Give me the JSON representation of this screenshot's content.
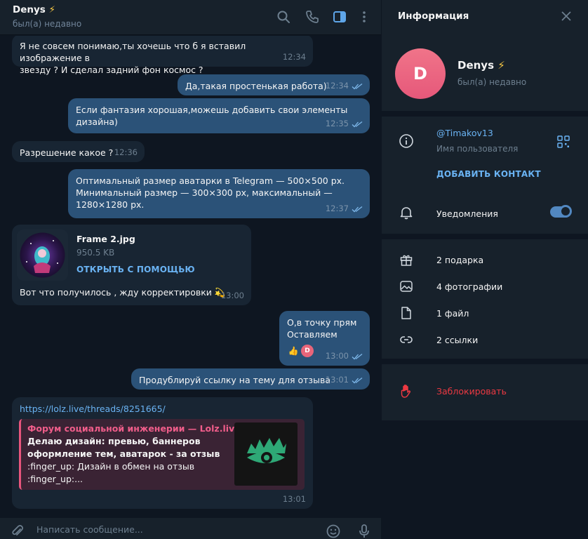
{
  "chat": {
    "title": "Denys",
    "title_emoji": "⚡",
    "status": "был(а) недавно",
    "header_icons": [
      "search-icon",
      "phone-icon",
      "sidebar-toggle-icon",
      "more-vert-icon"
    ]
  },
  "messages": [
    {
      "dir": "in",
      "text1": "Я не совсем понимаю,ты хочешь что б я вставил изображение в",
      "text2": "звезду ? И сделал задний фон космос ?",
      "time": "12:34"
    },
    {
      "dir": "out",
      "text": "Да,такая простенькая работа)",
      "time": "12:34",
      "read": true
    },
    {
      "dir": "out",
      "text1": "Если фантазия хорошая,можешь добавить свои элементы",
      "text2": "дизайна)",
      "time": "12:35",
      "read": true
    },
    {
      "dir": "in",
      "text": "Разрешение какое ?",
      "time": "12:36"
    },
    {
      "dir": "out",
      "text1": "Оптимальный размер аватарки в Telegram — 500×500 px.",
      "text2": "Минимальный размер — 300×300 px, максимальный —",
      "text3": "1280×1280 px.",
      "time": "12:37",
      "read": true
    },
    {
      "dir": "in",
      "file_name": "Frame 2.jpg",
      "file_size": "950.5 KB",
      "open_with": "ОТКРЫТЬ С ПОМОЩЬЮ",
      "caption": "Вот что получилось , жду корректировки",
      "caption_emoji": "💫",
      "time": "13:00"
    },
    {
      "dir": "out",
      "text1": "О,в точку прям",
      "text2": "Оставляем",
      "reaction_emoji": "👍",
      "reaction_avatar": "D",
      "time": "13:00",
      "read": true
    },
    {
      "dir": "out",
      "text": "Продублируй ссылку на тему для отзыва",
      "time": "13:01",
      "read": true
    },
    {
      "dir": "in",
      "url": "https://lolz.live/threads/8251665/",
      "preview_site": "Форум социальной инженерии — Lolz.live...",
      "preview_title1": "Делаю дизайн: превью, баннеров",
      "preview_title2": "оформление тем, аватарок - за отзыв",
      "preview_line3": ":finger_up:  Дизайн в обмен на отзыв",
      "preview_line4": ":finger_up:...",
      "time": "13:01"
    }
  ],
  "composer": {
    "placeholder": "Написать сообщение..."
  },
  "info": {
    "title": "Информация",
    "avatar_letter": "D",
    "name": "Denys",
    "name_emoji": "⚡",
    "status": "был(а) недавно",
    "username": "@Timakov13",
    "username_label": "Имя пользователя",
    "add_contact": "ДОБАВИТЬ КОНТАКТ",
    "notifications": "Уведомления",
    "notifications_on": true,
    "media": [
      {
        "icon": "gift-icon",
        "label": "2 подарка"
      },
      {
        "icon": "photo-icon",
        "label": "4 фотографии"
      },
      {
        "icon": "file-icon",
        "label": "1 файл"
      },
      {
        "icon": "link-icon",
        "label": "2 ссылки"
      }
    ],
    "block": "Заблокировать"
  },
  "colors": {
    "background": "#0e1621",
    "panel": "#17212b",
    "bubble_in": "#182533",
    "bubble_out": "#2b5278",
    "accent": "#6ab3f3",
    "danger": "#ec3942",
    "avatar": "#e6587a"
  }
}
